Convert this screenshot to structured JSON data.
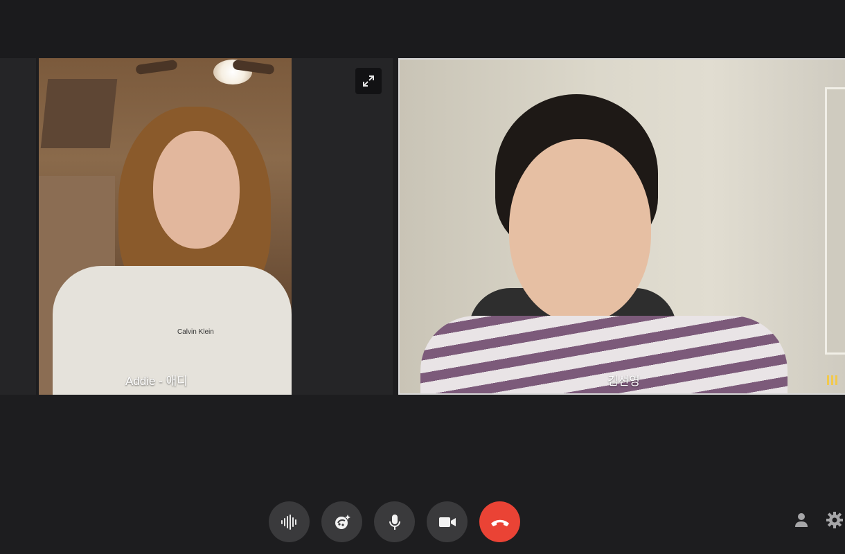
{
  "participants": [
    {
      "name": "Addie - 애디",
      "audio_active": false
    },
    {
      "name": "김선영",
      "audio_active": true
    }
  ],
  "shirt_logo": "Calvin Klein",
  "controls": {
    "voice_effects_icon": "audio-waveform-icon",
    "effects_icon": "sparkle-effects-icon",
    "mic_icon": "microphone-icon",
    "camera_icon": "video-camera-icon",
    "end_call_icon": "phone-hangup-icon"
  },
  "side_tools": [
    "person-icon",
    "gear-icon"
  ],
  "colors": {
    "background": "#1d1d1f",
    "control_button": "#3a3a3c",
    "end_call": "#ea4335",
    "active_speaker_border": "#d9d9d9",
    "audio_indicator": "#f2c94c"
  }
}
